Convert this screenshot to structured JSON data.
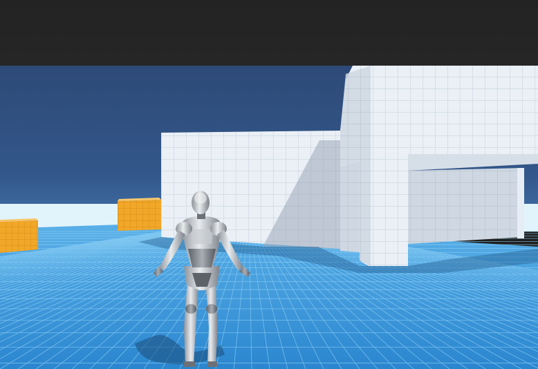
{
  "window": {
    "top_bar_color": "#232323"
  },
  "scene": {
    "sky_color": "#2f4f7d",
    "horizon_color": "#dff3fb",
    "ground_color": "#3a97d9",
    "wall_color": "#eef2f7",
    "crate_color": "#f1a728",
    "character": "humanoid-robot-mannequin"
  }
}
